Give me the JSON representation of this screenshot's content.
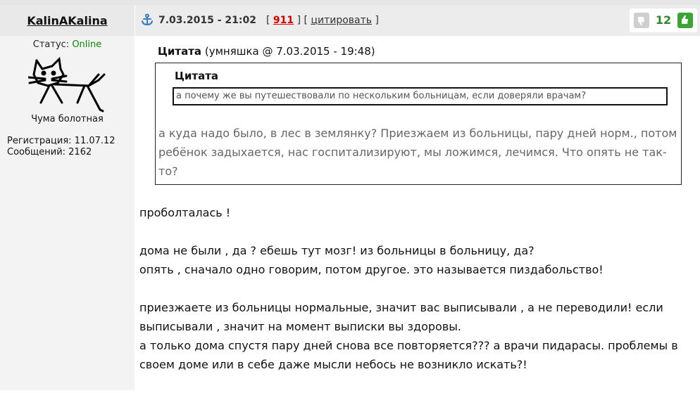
{
  "user": {
    "name": "KalinAKalina",
    "status_label": "Статус:",
    "status_value": "Online",
    "title": "Чума болотная",
    "registration": "Регистрация: 11.07.12",
    "messages": "Сообщений: 2162"
  },
  "post": {
    "anchor_icon": "anchor-icon",
    "datetime": "7.03.2015 - 21:02",
    "bracket_open": "[",
    "post_number": "911",
    "bracket_mid": "] [",
    "quote_link": "цитировать",
    "bracket_close": "]",
    "rating": "12"
  },
  "quote": {
    "label": "Цитата",
    "attribution": "(умняшка @ 7.03.2015 - 19:48)",
    "nested_label": "Цитата",
    "nested_text": "а почему же вы путешествовали по нескольким больницам, если доверяли врачам?",
    "reply_text": "а куда надо было, в лес в землянку? Приезжаем из больницы, пару дней норм., потом ребёнок задыхается, нас госпитализируют, мы ложимся, лечимся. Что опять не так-то?"
  },
  "body": {
    "p1": "проболталась !",
    "p2a": "дома не были , да ? ебешь тут мозг! из больницы в больницу, да?",
    "p2b": "опять , сначало одно говорим, потом другое. это называется пиздабольство!",
    "p3a": "приезжаете из больницы нормальные, значит вас выписывали , а не переводили! если выписывали , значит на момент выписки вы здоровы.",
    "p3b": "а только дома спустя пару дней снова все повторяется??? а врачи пидарасы. проблемы в своем доме или в себе даже мысли небось не возникло искать?!"
  },
  "colors": {
    "online": "#0a8a0a",
    "post_number": "#d40000",
    "rating": "#2a8a2a",
    "thumb_up": "#3aa435"
  }
}
